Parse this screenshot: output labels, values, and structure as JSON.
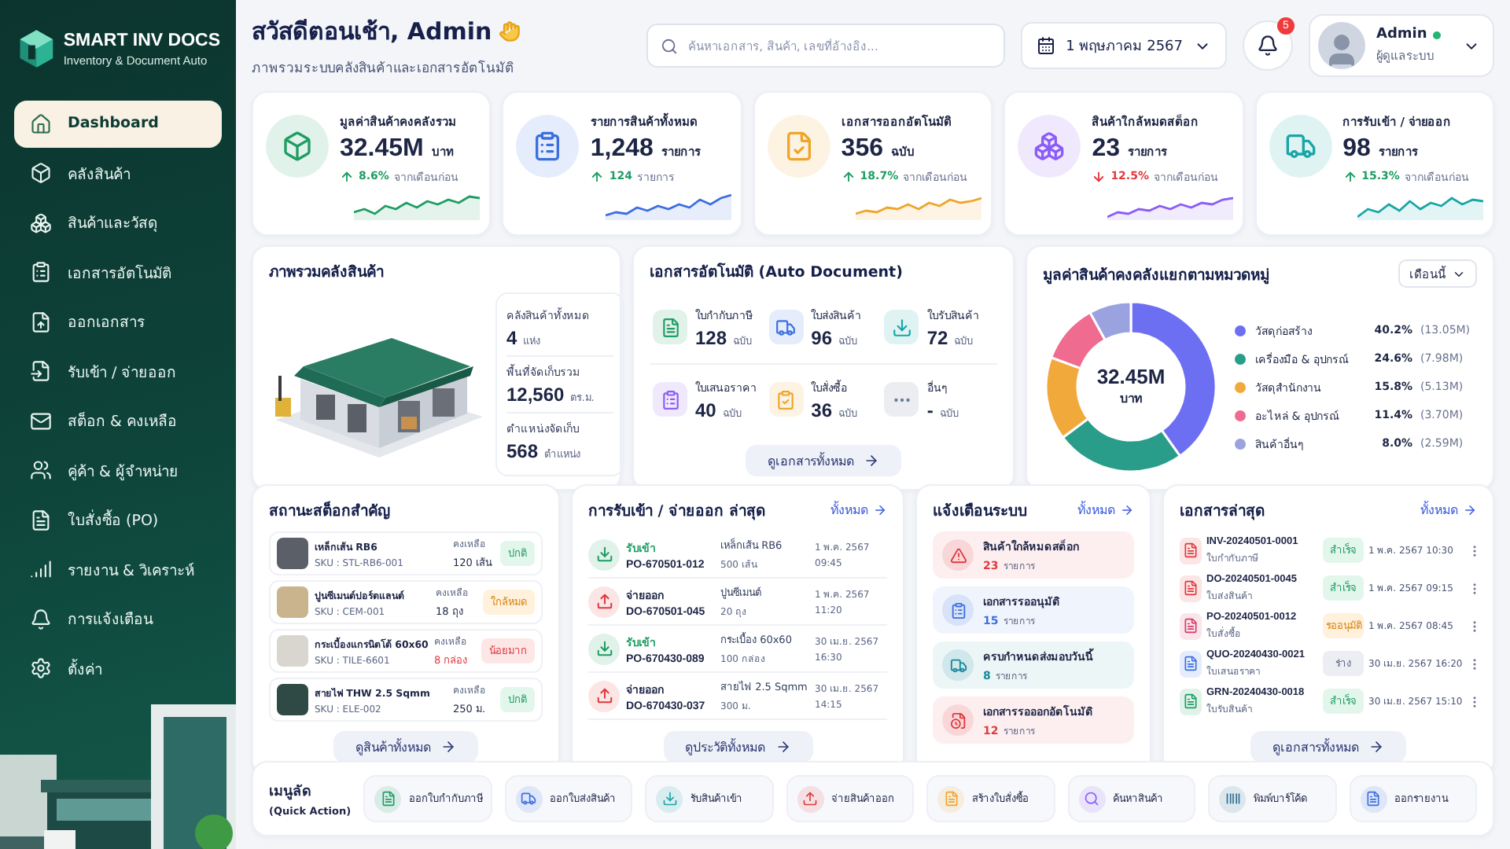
{
  "brand": {
    "name": "SMART INV DOCS",
    "tagline": "Inventory & Document Auto"
  },
  "sidebar": {
    "items": [
      {
        "label": "Dashboard",
        "selected": true
      },
      {
        "label": "คลังสินค้า",
        "selected": false
      },
      {
        "label": "สินค้าและวัสดุ",
        "selected": false
      },
      {
        "label": "เอกสารอัตโนมัติ",
        "selected": false
      },
      {
        "label": "ออกเอกสาร",
        "selected": false
      },
      {
        "label": "รับเข้า / จ่ายออก",
        "selected": false
      },
      {
        "label": "สต็อก & คงเหลือ",
        "selected": false
      },
      {
        "label": "คู่ค้า & ผู้จำหน่าย",
        "selected": false
      },
      {
        "label": "ใบสั่งซื้อ (PO)",
        "selected": false
      },
      {
        "label": "รายงาน & วิเคราะห์",
        "selected": false
      },
      {
        "label": "การแจ้งเตือน",
        "selected": false
      },
      {
        "label": "ตั้งค่า",
        "selected": false
      }
    ]
  },
  "header": {
    "greeting": "สวัสดีตอนเช้า, Admin",
    "subtitle": "ภาพรวมระบบคลังสินค้าและเอกสารอัตโนมัติ",
    "search": {
      "placeholder": "ค้นหาเอกสาร, สินค้า, เลขที่อ้างอิง..."
    },
    "date": "1 พฤษภาคม 2567",
    "notifications": "5",
    "user": {
      "name": "Admin",
      "role": "ผู้ดูแลระบบ",
      "online": true
    }
  },
  "kpis": [
    {
      "label": "มูลค่าสินค้าคงคลังรวม",
      "value": "32.45M",
      "unit": "บาท",
      "trend": {
        "kind": "up",
        "value": "8.6%",
        "note": "จากเดือนก่อน"
      },
      "color": "#1f9d63"
    },
    {
      "label": "รายการสินค้าทั้งหมด",
      "value": "1,248",
      "unit": "รายการ",
      "trend": {
        "kind": "up",
        "value": "124",
        "note": "รายการ"
      },
      "color": "#3b6fe0"
    },
    {
      "label": "เอกสารออกอัตโนมัติ",
      "value": "356",
      "unit": "ฉบับ",
      "trend": {
        "kind": "up",
        "value": "18.7%",
        "note": "จากเดือนก่อน"
      },
      "color": "#f0a52a"
    },
    {
      "label": "สินค้าใกล้หมดสต็อก",
      "value": "23",
      "unit": "รายการ",
      "trend": {
        "kind": "down",
        "value": "12.5%",
        "note": "จากเดือนก่อน"
      },
      "color": "#8b5cf6"
    },
    {
      "label": "การรับเข้า / จ่ายออก",
      "value": "98",
      "unit": "รายการ",
      "trend": {
        "kind": "up",
        "value": "15.3%",
        "note": "จากเดือนก่อน"
      },
      "color": "#18a6a6"
    }
  ],
  "warehouse": {
    "title": "ภาพรวมคลังสินค้า",
    "stats": [
      {
        "label": "คลังสินค้าทั้งหมด",
        "value": "4",
        "unit": "แห่ง"
      },
      {
        "label": "พื้นที่จัดเก็บรวม",
        "value": "12,560",
        "unit": "ตร.ม."
      },
      {
        "label": "ตำแหน่งจัดเก็บ",
        "value": "568",
        "unit": "ตำแหน่ง"
      }
    ]
  },
  "auto_documents": {
    "title": "เอกสารอัตโนมัติ (Auto Document)",
    "items": [
      {
        "label": "ใบกำกับภาษี",
        "value": "128",
        "unit": "ฉบับ",
        "color": "#1f9d63"
      },
      {
        "label": "ใบส่งสินค้า",
        "value": "96",
        "unit": "ฉบับ",
        "color": "#3b6fe0"
      },
      {
        "label": "ใบรับสินค้า",
        "value": "72",
        "unit": "ฉบับ",
        "color": "#18a6a6"
      },
      {
        "label": "ใบเสนอราคา",
        "value": "40",
        "unit": "ฉบับ",
        "color": "#8b5cf6"
      },
      {
        "label": "ใบสั่งซื้อ",
        "value": "36",
        "unit": "ฉบับ",
        "color": "#f0a52a"
      },
      {
        "label": "อื่นๆ",
        "value": "-",
        "unit": "ฉบับ",
        "color": "#6b7a99"
      }
    ],
    "button": "ดูเอกสารทั้งหมด"
  },
  "category_value": {
    "title": "มูลค่าสินค้าคงคลังแยกตามหมวดหมู่",
    "period": "เดือนนี้",
    "center_value": "32.45M",
    "center_unit": "บาท",
    "chart_data": {
      "type": "donut",
      "categories": [
        "วัสดุก่อสร้าง",
        "เครื่องมือ & อุปกรณ์",
        "วัสดุสำนักงาน",
        "อะไหล่ & อุปกรณ์",
        "สินค้าอื่นๆ"
      ],
      "values": [
        40.2,
        24.6,
        15.8,
        11.4,
        8.0
      ]
    },
    "legend": [
      {
        "percent": "40.2%",
        "amount": "(13.05M)",
        "color": "#6c6ff2"
      },
      {
        "percent": "24.6%",
        "amount": "(7.98M)",
        "color": "#2a9d8a"
      },
      {
        "percent": "15.8%",
        "amount": "(5.13M)",
        "color": "#f2a93b"
      },
      {
        "percent": "11.4%",
        "amount": "(3.70M)",
        "color": "#ef6b8f"
      },
      {
        "percent": "8.0%",
        "amount": "(2.59M)",
        "color": "#9aa3e0"
      }
    ]
  },
  "stock_status": {
    "title": "สถานะสต็อกสำคัญ",
    "items": [
      {
        "name": "เหล็กเส้น RB6",
        "sku": "SKU : STL-RB6-001",
        "remain_label": "คงเหลือ",
        "qty": "120 เส้น",
        "status": "ปกติ",
        "kind": "normal"
      },
      {
        "name": "ปูนซีเมนต์ปอร์ตแลนด์",
        "sku": "SKU : CEM-001",
        "remain_label": "คงเหลือ",
        "qty": "18 ถุง",
        "status": "ใกล้หมด",
        "kind": "low"
      },
      {
        "name": "กระเบื้องแกรนิตโต้ 60x60",
        "sku": "SKU : TILE-6601",
        "remain_label": "คงเหลือ",
        "qty": "8 กล่อง",
        "status": "น้อยมาก",
        "kind": "critical"
      },
      {
        "name": "สายไฟ THW 2.5 Sqmm",
        "sku": "SKU : ELE-002",
        "remain_label": "คงเหลือ",
        "qty": "250 ม.",
        "status": "ปกติ",
        "kind": "normal"
      }
    ],
    "button": "ดูสินค้าทั้งหมด"
  },
  "transactions": {
    "title": "การรับเข้า / จ่ายออก ล่าสุด",
    "link": "ทั้งหมด",
    "items": [
      {
        "kind": "in",
        "type": "รับเข้า",
        "ref": "PO-670501-012",
        "item": "เหล็กเส้น RB6",
        "qty": "500 เส้น",
        "date": "1 พ.ค. 2567",
        "time": "09:45"
      },
      {
        "kind": "out",
        "type": "จ่ายออก",
        "ref": "DO-670501-045",
        "item": "ปูนซีเมนต์",
        "qty": "20 ถุง",
        "date": "1 พ.ค. 2567",
        "time": "11:20"
      },
      {
        "kind": "in",
        "type": "รับเข้า",
        "ref": "PO-670430-089",
        "item": "กระเบื้อง 60x60",
        "qty": "100 กล่อง",
        "date": "30 เม.ย. 2567",
        "time": "16:30"
      },
      {
        "kind": "out",
        "type": "จ่ายออก",
        "ref": "DO-670430-037",
        "item": "สายไฟ 2.5 Sqmm",
        "qty": "300 ม.",
        "date": "30 เม.ย. 2567",
        "time": "14:15"
      }
    ],
    "button": "ดูประวัติทั้งหมด"
  },
  "alerts": {
    "title": "แจ้งเตือนระบบ",
    "link": "ทั้งหมด",
    "items": [
      {
        "title": "สินค้าใกล้หมดสต็อก",
        "count": "23",
        "unit": "รายการ",
        "color": "#e0393e"
      },
      {
        "title": "เอกสารรออนุมัติ",
        "count": "15",
        "unit": "รายการ",
        "color": "#3b6fe0"
      },
      {
        "title": "ครบกำหนดส่งมอบวันนี้",
        "count": "8",
        "unit": "รายการ",
        "color": "#18899a"
      },
      {
        "title": "เอกสารรอออกอัตโนมัติ",
        "count": "12",
        "unit": "รายการ",
        "color": "#e0393e"
      }
    ]
  },
  "recent_documents": {
    "title": "เอกสารล่าสุด",
    "link": "ทั้งหมด",
    "items": [
      {
        "ref": "INV-20240501-0001",
        "type": "ใบกำกับภาษี",
        "status": "สำเร็จ",
        "kind": "success",
        "datetime": "1 พ.ค. 2567 10:30",
        "color": "#e0393e"
      },
      {
        "ref": "DO-20240501-0045",
        "type": "ใบส่งสินค้า",
        "status": "สำเร็จ",
        "kind": "success",
        "datetime": "1 พ.ค. 2567 09:15",
        "color": "#e0393e"
      },
      {
        "ref": "PO-20240501-0012",
        "type": "ใบสั่งซื้อ",
        "status": "รออนุมัติ",
        "kind": "pending",
        "datetime": "1 พ.ค. 2567 08:45",
        "color": "#d63a6a"
      },
      {
        "ref": "QUO-20240430-0021",
        "type": "ใบเสนอราคา",
        "status": "ร่าง",
        "kind": "draft",
        "datetime": "30 เม.ย. 2567 16:20",
        "color": "#3b6fe0"
      },
      {
        "ref": "GRN-20240430-0018",
        "type": "ใบรับสินค้า",
        "status": "สำเร็จ",
        "kind": "success",
        "datetime": "30 เม.ย. 2567 15:10",
        "color": "#1f9d63"
      }
    ],
    "button": "ดูเอกสารทั้งหมด"
  },
  "quick_actions": {
    "title": "เมนูลัด",
    "subtitle": "(Quick Action)",
    "items": [
      {
        "label": "ออกใบกำกับภาษี",
        "color": "#1f9d63"
      },
      {
        "label": "ออกใบส่งสินค้า",
        "color": "#3b6fe0"
      },
      {
        "label": "รับสินค้าเข้า",
        "color": "#18a6a6"
      },
      {
        "label": "จ่ายสินค้าออก",
        "color": "#e0393e"
      },
      {
        "label": "สร้างใบสั่งซื้อ",
        "color": "#f0a52a"
      },
      {
        "label": "ค้นหาสินค้า",
        "color": "#8b5cf6"
      },
      {
        "label": "พิมพ์บาร์โค้ด",
        "color": "#2f6f8f"
      },
      {
        "label": "ออกรายงาน",
        "color": "#3b6fe0"
      }
    ]
  }
}
